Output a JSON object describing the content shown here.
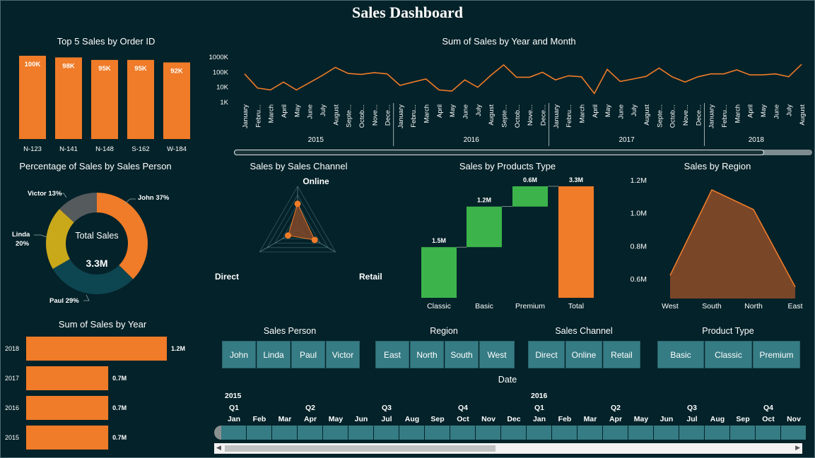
{
  "dashboard": {
    "title": "Sales Dashboard"
  },
  "colors": {
    "background": "#042229",
    "orange": "#f07b28",
    "green": "#3cb44b",
    "teal": "#367c84",
    "darkteal": "#0d4550",
    "yellow": "#c9a81a",
    "gray": "#555a5c",
    "area": "#7a4628"
  },
  "chart_data": [
    {
      "id": "top5",
      "type": "bar",
      "title": "Top 5 Sales by Order ID",
      "categories": [
        "N-123",
        "N-141",
        "N-148",
        "S-162",
        "W-184"
      ],
      "values": [
        100,
        98,
        95,
        95,
        92
      ],
      "labels": [
        "100K",
        "98K",
        "95K",
        "95K",
        "92K"
      ]
    },
    {
      "id": "monthly",
      "type": "line",
      "title": "Sum of Sales by Year and Month",
      "y_scale": "log",
      "y_ticks": [
        "1K",
        "10K",
        "100K",
        "1000K"
      ],
      "ylim": [
        1,
        1000
      ],
      "groups": [
        {
          "year": "2015",
          "months": [
            "January",
            "Febru...",
            "March",
            "April",
            "May",
            "June",
            "July",
            "August",
            "Septe...",
            "Octob...",
            "Nove...",
            "Dece..."
          ]
        },
        {
          "year": "2016",
          "months": [
            "January",
            "Febru...",
            "March",
            "April",
            "May",
            "June",
            "July",
            "August",
            "Septe...",
            "Octob...",
            "Nove...",
            "Dece..."
          ]
        },
        {
          "year": "2017",
          "months": [
            "January",
            "Febru...",
            "March",
            "April",
            "May",
            "June",
            "July",
            "August",
            "Septe...",
            "Octob...",
            "Nove...",
            "Dece..."
          ]
        },
        {
          "year": "2018",
          "months": [
            "January",
            "Febru...",
            "March",
            "April",
            "May",
            "June",
            "July",
            "August"
          ]
        }
      ],
      "values": [
        70,
        8,
        6,
        20,
        6,
        18,
        55,
        190,
        75,
        65,
        85,
        70,
        12,
        20,
        32,
        6,
        5,
        28,
        9,
        55,
        280,
        42,
        42,
        90,
        28,
        52,
        45,
        3.5,
        140,
        22,
        32,
        48,
        170,
        45,
        20,
        45,
        70,
        70,
        130,
        60,
        60,
        70,
        45,
        300
      ]
    },
    {
      "id": "person",
      "type": "pie",
      "title": "Percentage of Sales by Sales Person",
      "center_label": "Total Sales",
      "center_value": "3.3M",
      "slices": [
        {
          "name": "John",
          "value": 37,
          "label": "John 37%"
        },
        {
          "name": "Paul",
          "value": 29,
          "label": "Paul 29%"
        },
        {
          "name": "Linda",
          "value": 20,
          "label": "Linda 20%"
        },
        {
          "name": "Victor",
          "value": 13,
          "label": "Victor 13%"
        }
      ]
    },
    {
      "id": "channel",
      "type": "radar",
      "title": "Sales by Sales Channel",
      "axes": [
        "Online",
        "Retail",
        "Direct"
      ],
      "values": [
        0.6,
        0.45,
        0.25
      ]
    },
    {
      "id": "product",
      "type": "waterfall",
      "title": "Sales by Products Type",
      "categories": [
        "Classic",
        "Basic",
        "Premium",
        "Total"
      ],
      "values": [
        1.5,
        1.2,
        0.6,
        3.3
      ],
      "labels": [
        "1.5M",
        "1.2M",
        "0.6M",
        "3.3M"
      ]
    },
    {
      "id": "region",
      "type": "area",
      "title": "Sales by Region",
      "categories": [
        "West",
        "South",
        "North",
        "East"
      ],
      "values": [
        0.62,
        1.14,
        1.02,
        0.55
      ],
      "y_ticks": [
        "0.6M",
        "0.8M",
        "1.0M",
        "1.2M"
      ],
      "ylim": [
        0.48,
        1.2
      ]
    },
    {
      "id": "yearly",
      "type": "bar",
      "orientation": "horizontal",
      "title": "Sum of Sales by Year",
      "categories": [
        "2018",
        "2017",
        "2016",
        "2015"
      ],
      "values": [
        1.2,
        0.7,
        0.7,
        0.7
      ],
      "labels": [
        "1.2M",
        "0.7M",
        "0.7M",
        "0.7M"
      ]
    }
  ],
  "slicers": {
    "sales_person": {
      "title": "Sales Person",
      "items": [
        "John",
        "Linda",
        "Paul",
        "Victor"
      ]
    },
    "region": {
      "title": "Region",
      "items": [
        "East",
        "North",
        "South",
        "West"
      ]
    },
    "sales_channel": {
      "title": "Sales Channel",
      "items": [
        "Direct",
        "Online",
        "Retail"
      ]
    },
    "product_type": {
      "title": "Product Type",
      "items": [
        "Basic",
        "Classic",
        "Premium"
      ]
    }
  },
  "date_slicer": {
    "title": "Date",
    "years": [
      "2015",
      "2016"
    ],
    "quarters": [
      "Q1",
      "Q2",
      "Q3",
      "Q4",
      "Q1",
      "Q2",
      "Q3",
      "Q4"
    ],
    "months": [
      "Jan",
      "Feb",
      "Mar",
      "Apr",
      "May",
      "Jun",
      "Jul",
      "Aug",
      "Sep",
      "Oct",
      "Nov",
      "Dec",
      "Jan",
      "Feb",
      "Mar",
      "Apr",
      "May",
      "Jun",
      "Jul",
      "Aug",
      "Sep",
      "Oct",
      "Nov"
    ]
  }
}
